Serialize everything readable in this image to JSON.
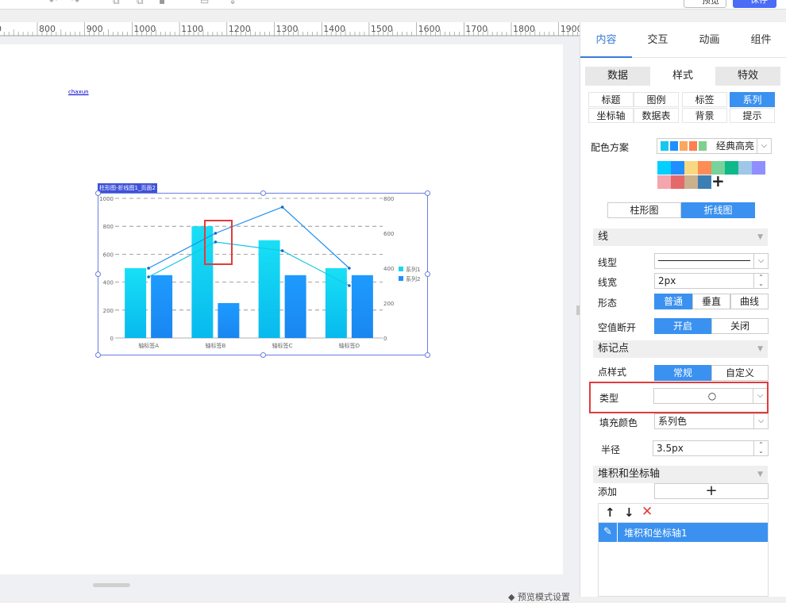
{
  "toolbar": {
    "preview_label": "预览",
    "save_label": "保存"
  },
  "ruler": {
    "ticks": [
      "800",
      "900",
      "1000",
      "1100",
      "1200",
      "1300",
      "1400",
      "1500",
      "1600",
      "1700",
      "1800",
      "1900"
    ]
  },
  "canvas": {
    "link_text": "chaxun",
    "bottom_hint": "◆ 预览模式设置"
  },
  "chart_widget": {
    "tag": "柱形图-折线图1_页面2",
    "chart_data": {
      "type": "bar",
      "categories": [
        "轴标签A",
        "轴标签B",
        "轴标签C",
        "轴标签D"
      ],
      "series": [
        {
          "name": "系列1",
          "type": "bar",
          "values": [
            500,
            800,
            700,
            500
          ]
        },
        {
          "name": "系列2",
          "type": "bar",
          "values": [
            450,
            250,
            450,
            450
          ]
        },
        {
          "name": "",
          "type": "line",
          "axis": "right",
          "values": [
            400,
            600,
            750,
            400
          ]
        },
        {
          "name": "",
          "type": "line",
          "axis": "right",
          "values": [
            350,
            550,
            500,
            300
          ]
        }
      ],
      "left_ticks": [
        "0",
        "200",
        "400",
        "600",
        "800",
        "1000"
      ],
      "right_ticks": [
        "0",
        "200",
        "400",
        "600",
        "800"
      ],
      "ylim": [
        0,
        1000
      ],
      "y2lim": [
        0,
        800
      ],
      "legend_position": "right",
      "grid": true
    }
  },
  "panel": {
    "tabs": [
      "内容",
      "交互",
      "动画",
      "组件"
    ],
    "subtabs": [
      "数据",
      "样式",
      "特效"
    ],
    "style_tabs_row1": [
      "标题",
      "图例",
      "标签",
      "系列"
    ],
    "style_tabs_row2": [
      "坐标轴",
      "数据表",
      "背景",
      "提示"
    ],
    "color_scheme_label": "配色方案",
    "color_scheme_value": "经典高亮",
    "scheme_mini_colors": [
      "#16c8f0",
      "#1e90ff",
      "#f8a860",
      "#ff7f50",
      "#7fd08f"
    ],
    "palette_colors": [
      "#00cfff",
      "#1f8fff",
      "#f8d880",
      "#ff8c55",
      "#78d39a",
      "#10b98a",
      "#9ec7e8",
      "#8f8fff",
      "#f5a5ad",
      "#e5696a",
      "#cbb08e",
      "#3d7fb5"
    ],
    "chart_type_options": [
      "柱形图",
      "折线图"
    ],
    "line_section": "线",
    "line_type_label": "线型",
    "line_width_label": "线宽",
    "line_width_value": "2px",
    "shape_label": "形态",
    "shape_options": [
      "普通",
      "垂直",
      "曲线"
    ],
    "null_break_label": "空值断开",
    "null_break_options": [
      "开启",
      "关闭"
    ],
    "marker_section": "标记点",
    "marker_style_label": "点样式",
    "marker_style_options": [
      "常规",
      "自定义"
    ],
    "marker_type_label": "类型",
    "marker_type_value": "○",
    "fill_color_label": "填充颜色",
    "fill_color_value": "系列色",
    "radius_label": "半径",
    "radius_value": "3.5px",
    "stack_section": "堆积和坐标轴",
    "add_label": "添加",
    "add_icon": "+",
    "list_item": "堆积和坐标轴1"
  }
}
